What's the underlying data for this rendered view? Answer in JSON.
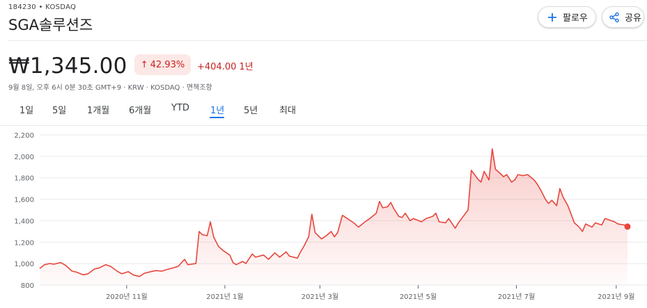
{
  "header": {
    "ticker": "184230 • KOSDAQ",
    "company": "SGA솔루션즈",
    "follow_label": "팔로우",
    "share_label": "공유"
  },
  "quote": {
    "price": "₩1,345.00",
    "pct_change": "42.93%",
    "abs_change": "+404.00",
    "period": "1년",
    "meta": "9월 8일, 오후 6시 0분 30초 GMT+9 · KRW · KOSDAQ · 면책조항"
  },
  "tabs": [
    {
      "label": "1일",
      "active": false
    },
    {
      "label": "5일",
      "active": false
    },
    {
      "label": "1개월",
      "active": false
    },
    {
      "label": "6개월",
      "active": false
    },
    {
      "label": "YTD",
      "active": false
    },
    {
      "label": "1년",
      "active": true
    },
    {
      "label": "5년",
      "active": false
    },
    {
      "label": "최대",
      "active": false
    }
  ],
  "colors": {
    "line": "#e8453c",
    "negative_text": "#c5221f",
    "badge_bg": "#fce8e6",
    "accent": "#1a73e8"
  },
  "icons": {
    "follow": "plus-icon",
    "share": "share-icon",
    "up": "arrow-up-icon"
  },
  "chart_data": {
    "type": "area",
    "ylim": [
      800,
      2200
    ],
    "yticks": [
      800,
      1000,
      1200,
      1400,
      1600,
      1800,
      2000,
      2200
    ],
    "ytick_labels": [
      "800",
      "1,000",
      "1,200",
      "1,400",
      "1,600",
      "1,800",
      "2,000",
      "2,200"
    ],
    "xticks": [
      {
        "label": "2020년 11월",
        "date": "2020-11-01"
      },
      {
        "label": "2021년 1월",
        "date": "2021-01-01"
      },
      {
        "label": "2021년 3월",
        "date": "2021-03-01"
      },
      {
        "label": "2021년 5월",
        "date": "2021-05-01"
      },
      {
        "label": "2021년 7월",
        "date": "2021-07-01"
      },
      {
        "label": "2021년 9월",
        "date": "2021-09-01"
      }
    ],
    "x_range": [
      "2020-09-08",
      "2021-09-08"
    ],
    "series": [
      {
        "values": [
          [
            "2020-09-08",
            955
          ],
          [
            "2020-09-11",
            990
          ],
          [
            "2020-09-14",
            1000
          ],
          [
            "2020-09-17",
            995
          ],
          [
            "2020-09-21",
            1010
          ],
          [
            "2020-09-24",
            985
          ],
          [
            "2020-09-28",
            930
          ],
          [
            "2020-10-01",
            920
          ],
          [
            "2020-10-05",
            895
          ],
          [
            "2020-10-08",
            905
          ],
          [
            "2020-10-12",
            950
          ],
          [
            "2020-10-15",
            960
          ],
          [
            "2020-10-19",
            990
          ],
          [
            "2020-10-22",
            975
          ],
          [
            "2020-10-26",
            930
          ],
          [
            "2020-10-29",
            905
          ],
          [
            "2020-11-02",
            925
          ],
          [
            "2020-11-05",
            895
          ],
          [
            "2020-11-09",
            880
          ],
          [
            "2020-11-12",
            910
          ],
          [
            "2020-11-16",
            925
          ],
          [
            "2020-11-19",
            935
          ],
          [
            "2020-11-23",
            930
          ],
          [
            "2020-11-26",
            945
          ],
          [
            "2020-11-30",
            960
          ],
          [
            "2020-12-03",
            975
          ],
          [
            "2020-12-07",
            1040
          ],
          [
            "2020-12-09",
            990
          ],
          [
            "2020-12-14",
            1000
          ],
          [
            "2020-12-16",
            1300
          ],
          [
            "2020-12-18",
            1270
          ],
          [
            "2020-12-21",
            1260
          ],
          [
            "2020-12-23",
            1390
          ],
          [
            "2020-12-25",
            1250
          ],
          [
            "2020-12-28",
            1160
          ],
          [
            "2020-12-31",
            1120
          ],
          [
            "2021-01-04",
            1080
          ],
          [
            "2021-01-06",
            1010
          ],
          [
            "2021-01-08",
            990
          ],
          [
            "2021-01-12",
            1020
          ],
          [
            "2021-01-14",
            1000
          ],
          [
            "2021-01-18",
            1090
          ],
          [
            "2021-01-20",
            1060
          ],
          [
            "2021-01-25",
            1080
          ],
          [
            "2021-01-28",
            1040
          ],
          [
            "2021-02-01",
            1100
          ],
          [
            "2021-02-04",
            1060
          ],
          [
            "2021-02-08",
            1110
          ],
          [
            "2021-02-10",
            1070
          ],
          [
            "2021-02-15",
            1050
          ],
          [
            "2021-02-17",
            1110
          ],
          [
            "2021-02-19",
            1160
          ],
          [
            "2021-02-22",
            1250
          ],
          [
            "2021-02-24",
            1460
          ],
          [
            "2021-02-26",
            1290
          ],
          [
            "2021-03-02",
            1230
          ],
          [
            "2021-03-05",
            1260
          ],
          [
            "2021-03-08",
            1300
          ],
          [
            "2021-03-10",
            1250
          ],
          [
            "2021-03-12",
            1290
          ],
          [
            "2021-03-15",
            1450
          ],
          [
            "2021-03-18",
            1420
          ],
          [
            "2021-03-22",
            1380
          ],
          [
            "2021-03-25",
            1340
          ],
          [
            "2021-03-29",
            1390
          ],
          [
            "2021-04-01",
            1420
          ],
          [
            "2021-04-05",
            1470
          ],
          [
            "2021-04-07",
            1580
          ],
          [
            "2021-04-09",
            1520
          ],
          [
            "2021-04-12",
            1530
          ],
          [
            "2021-04-14",
            1570
          ],
          [
            "2021-04-16",
            1510
          ],
          [
            "2021-04-19",
            1440
          ],
          [
            "2021-04-21",
            1430
          ],
          [
            "2021-04-23",
            1470
          ],
          [
            "2021-04-26",
            1400
          ],
          [
            "2021-04-28",
            1420
          ],
          [
            "2021-05-03",
            1390
          ],
          [
            "2021-05-06",
            1420
          ],
          [
            "2021-05-10",
            1440
          ],
          [
            "2021-05-12",
            1470
          ],
          [
            "2021-05-14",
            1390
          ],
          [
            "2021-05-18",
            1380
          ],
          [
            "2021-05-20",
            1420
          ],
          [
            "2021-05-24",
            1330
          ],
          [
            "2021-05-26",
            1380
          ],
          [
            "2021-05-28",
            1420
          ],
          [
            "2021-06-01",
            1500
          ],
          [
            "2021-06-03",
            1870
          ],
          [
            "2021-06-07",
            1790
          ],
          [
            "2021-06-09",
            1760
          ],
          [
            "2021-06-11",
            1860
          ],
          [
            "2021-06-14",
            1780
          ],
          [
            "2021-06-16",
            2070
          ],
          [
            "2021-06-18",
            1880
          ],
          [
            "2021-06-21",
            1840
          ],
          [
            "2021-06-23",
            1810
          ],
          [
            "2021-06-25",
            1830
          ],
          [
            "2021-06-28",
            1760
          ],
          [
            "2021-06-30",
            1780
          ],
          [
            "2021-07-02",
            1830
          ],
          [
            "2021-07-05",
            1820
          ],
          [
            "2021-07-08",
            1830
          ],
          [
            "2021-07-12",
            1780
          ],
          [
            "2021-07-14",
            1740
          ],
          [
            "2021-07-16",
            1690
          ],
          [
            "2021-07-19",
            1600
          ],
          [
            "2021-07-21",
            1560
          ],
          [
            "2021-07-23",
            1590
          ],
          [
            "2021-07-26",
            1540
          ],
          [
            "2021-07-28",
            1700
          ],
          [
            "2021-07-30",
            1620
          ],
          [
            "2021-08-02",
            1540
          ],
          [
            "2021-08-04",
            1460
          ],
          [
            "2021-08-06",
            1380
          ],
          [
            "2021-08-09",
            1340
          ],
          [
            "2021-08-11",
            1300
          ],
          [
            "2021-08-13",
            1370
          ],
          [
            "2021-08-17",
            1340
          ],
          [
            "2021-08-19",
            1380
          ],
          [
            "2021-08-23",
            1360
          ],
          [
            "2021-08-25",
            1420
          ],
          [
            "2021-08-27",
            1410
          ],
          [
            "2021-08-31",
            1390
          ],
          [
            "2021-09-02",
            1370
          ],
          [
            "2021-09-06",
            1360
          ],
          [
            "2021-09-08",
            1345
          ]
        ]
      }
    ]
  }
}
